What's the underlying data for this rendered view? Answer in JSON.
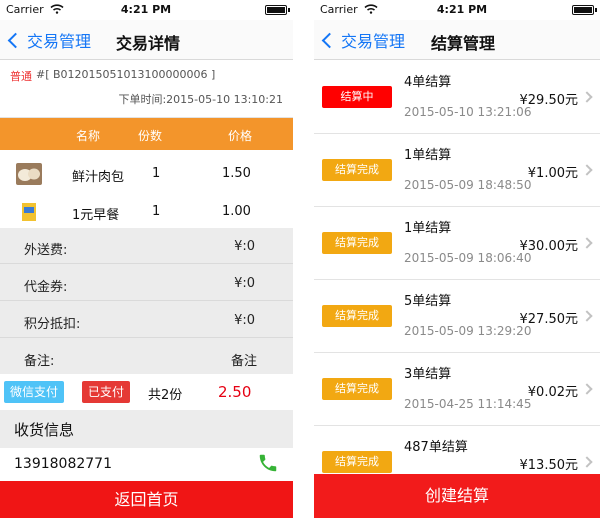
{
  "colors": {
    "accent_blue": "#1476f6",
    "orange": "#f3952b",
    "red": "#f01515",
    "badge_red": "#ff0000",
    "badge_orange": "#f2a812",
    "wechat_blue": "#4fc3f7",
    "paid_red": "#e53935",
    "phone_green": "#36b336"
  },
  "left": {
    "status": {
      "carrier": "Carrier",
      "time": "4:21 PM"
    },
    "nav": {
      "back_label": "交易管理",
      "title": "交易详情"
    },
    "order": {
      "type": "普通",
      "number": "#[ B012015051013100000006 ]",
      "time": "下单时间:2015-05-10 13:10:21"
    },
    "table": {
      "headers": {
        "name": "名称",
        "qty": "份数",
        "price": "价格"
      },
      "rows": [
        {
          "name": "鲜汁肉包",
          "qty": "1",
          "price": "1.50",
          "icon": "bun-food-icon"
        },
        {
          "name": "1元早餐",
          "qty": "1",
          "price": "1.00",
          "icon": "breakfast-pack-icon"
        }
      ]
    },
    "fees": [
      {
        "label": "外送费:",
        "value": "¥:0"
      },
      {
        "label": "代金券:",
        "value": "¥:0"
      },
      {
        "label": "积分抵扣:",
        "value": "¥:0"
      },
      {
        "label": "备注:",
        "value": "备注"
      }
    ],
    "payment": {
      "method": "微信支付",
      "status": "已支付",
      "total_label": "共2份",
      "amount": "2.50"
    },
    "shipping": {
      "title": "收货信息",
      "phone": "13918082771",
      "phone_icon": "phone-icon"
    },
    "button": "返回首页"
  },
  "right": {
    "status": {
      "carrier": "Carrier",
      "time": "4:21 PM"
    },
    "nav": {
      "back_label": "交易管理",
      "title": "结算管理"
    },
    "items": [
      {
        "status": "结算中",
        "status_color": "#ff0000",
        "name": "4单结算",
        "date": "2015-05-10 13:21:06",
        "amount": "¥29.50元"
      },
      {
        "status": "结算完成",
        "status_color": "#f2a812",
        "name": "1单结算",
        "date": "2015-05-09 18:48:50",
        "amount": "¥1.00元"
      },
      {
        "status": "结算完成",
        "status_color": "#f2a812",
        "name": "1单结算",
        "date": "2015-05-09 18:06:40",
        "amount": "¥30.00元"
      },
      {
        "status": "结算完成",
        "status_color": "#f2a812",
        "name": "5单结算",
        "date": "2015-05-09 13:29:20",
        "amount": "¥27.50元"
      },
      {
        "status": "结算完成",
        "status_color": "#f2a812",
        "name": "3单结算",
        "date": "2015-04-25 11:14:45",
        "amount": "¥0.02元"
      },
      {
        "status": "结算完成",
        "status_color": "#f2a812",
        "name": "487单结算",
        "date": "",
        "amount": "¥13.50元"
      }
    ],
    "button": "创建结算"
  }
}
